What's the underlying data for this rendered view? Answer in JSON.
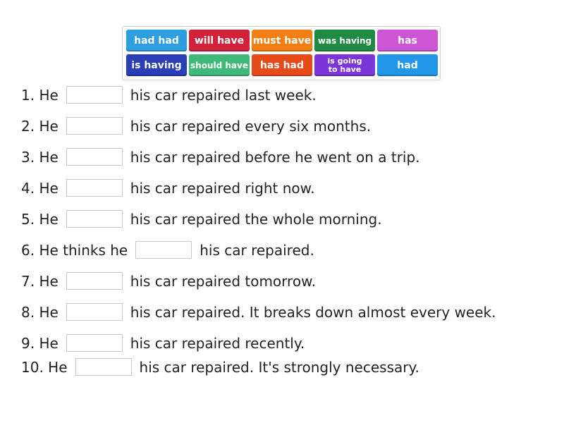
{
  "word_bank": [
    {
      "label": "had had",
      "color": "#2d9ee0"
    },
    {
      "label": "will have",
      "color": "#d2223b"
    },
    {
      "label": "must have",
      "color": "#f57f17"
    },
    {
      "label": "was having",
      "color": "#1e8a44"
    },
    {
      "label": "has",
      "color": "#cc56d6"
    },
    {
      "label": "is having",
      "color": "#2a3fb5"
    },
    {
      "label": "should have",
      "color": "#3fb87a"
    },
    {
      "label": "has had",
      "color": "#e64a19"
    },
    {
      "label": "is going to have",
      "color": "#7b35d9"
    },
    {
      "label": "had",
      "color": "#2196e8"
    }
  ],
  "questions": [
    {
      "prefix": "1. He",
      "suffix": "his car repaired last week."
    },
    {
      "prefix": "2. He",
      "suffix": "his car repaired every six months."
    },
    {
      "prefix": "3. He",
      "suffix": "his car repaired before he went on a trip."
    },
    {
      "prefix": "4. He",
      "suffix": "his car repaired right now."
    },
    {
      "prefix": "5. He",
      "suffix": "his car repaired the whole morning."
    },
    {
      "prefix": "6. He thinks he",
      "suffix": "his car repaired."
    },
    {
      "prefix": "7. He",
      "suffix": "his car repaired tomorrow."
    },
    {
      "prefix": "8. He",
      "suffix": "his car repaired. It breaks down almost every week."
    },
    {
      "prefix": "9. He",
      "suffix": "his car repaired recently."
    },
    {
      "prefix": "10. He",
      "suffix": "his car repaired. It's strongly necessary."
    }
  ]
}
